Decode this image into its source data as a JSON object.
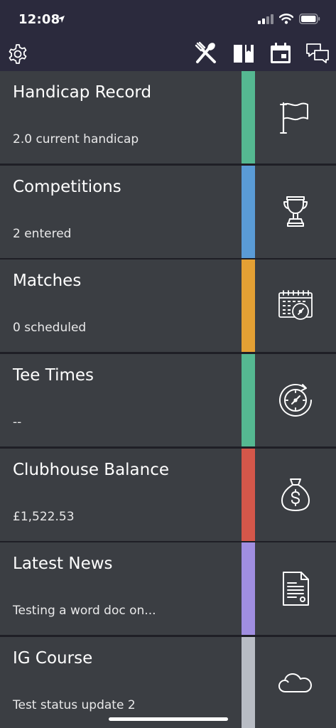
{
  "status_bar": {
    "time": "12:08"
  },
  "toolbar": {
    "icons": [
      "gear-icon",
      "fork-knife-icon",
      "book-icon",
      "calendar-icon",
      "chat-icon"
    ]
  },
  "tiles": [
    {
      "title": "Handicap Record",
      "subtitle": "2.0 current handicap",
      "color": "#55b891",
      "icon": "flag-icon"
    },
    {
      "title": "Competitions",
      "subtitle": "2 entered",
      "color": "#5a9bd6",
      "icon": "trophy-icon"
    },
    {
      "title": "Matches",
      "subtitle": "0 scheduled",
      "color": "#e4a034",
      "icon": "calendar-clock-icon"
    },
    {
      "title": "Tee Times",
      "subtitle": "--",
      "color": "#55b891",
      "icon": "clock-refresh-icon"
    },
    {
      "title": "Clubhouse Balance",
      "subtitle": "£1,522.53",
      "color": "#d4574a",
      "icon": "money-bag-icon"
    },
    {
      "title": "Latest News",
      "subtitle": "Testing a word doc on...",
      "color": "#a08ee0",
      "icon": "document-icon"
    },
    {
      "title": "IG Course",
      "subtitle": "Test status update 2",
      "color": "#b8bcc4",
      "icon": "cloud-icon"
    }
  ]
}
